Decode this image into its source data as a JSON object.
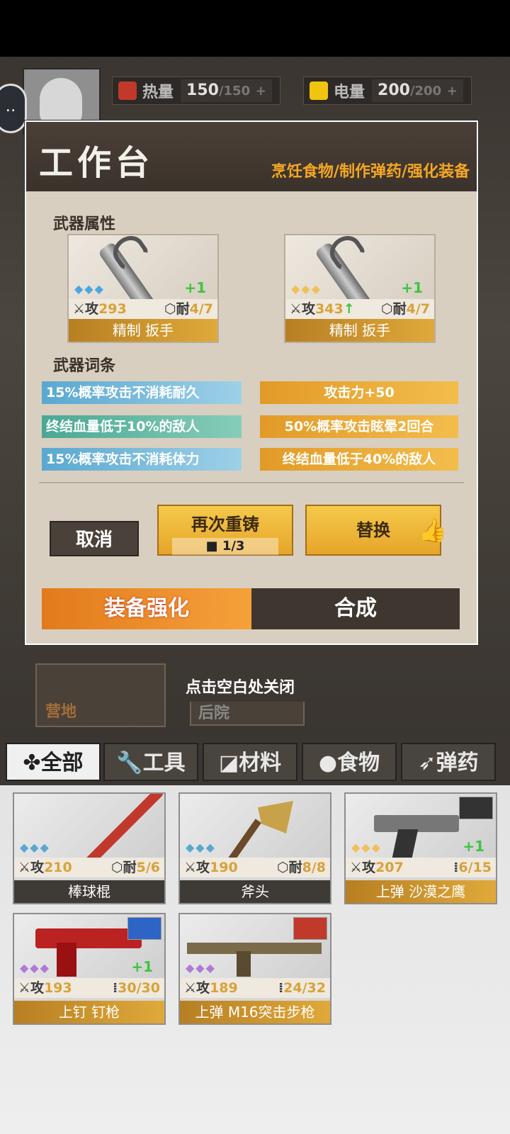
{
  "hud": {
    "heat_label": "热量",
    "heat_value": "150",
    "heat_max": "/150",
    "heat_plus": "+",
    "power_label": "电量",
    "power_value": "200",
    "power_max": "/200",
    "power_plus": "+"
  },
  "modal": {
    "title": "工作台",
    "subtitle": "烹饪食物/制作弹药/强化装备",
    "attr_label": "武器属性",
    "affix_label": "武器词条",
    "cards": [
      {
        "gems": "◆◆◆",
        "plus": "+1",
        "atk_label": "攻",
        "atk": "293",
        "dur_label": "耐",
        "dur": "4/7",
        "name": "精制 扳手"
      },
      {
        "gems": "◆◆◆",
        "plus": "+1",
        "atk_label": "攻",
        "atk": "343",
        "atk_up": "↑",
        "dur_label": "耐",
        "dur": "4/7",
        "name": "精制 扳手"
      }
    ],
    "affixes_left": [
      "15%概率攻击不消耗耐久",
      "终结血量低于10%的敌人",
      "15%概率攻击不消耗体力"
    ],
    "affixes_right": [
      "攻击力+50",
      "50%概率攻击眩晕2回合",
      "终结血量低于40%的敌人"
    ],
    "cancel": "取消",
    "recast": "再次重铸",
    "recast_count": "1/3",
    "replace": "替换",
    "tab_enhance": "装备强化",
    "tab_synth": "合成"
  },
  "close_hint": "点击空白处关闭",
  "bg_tiles": {
    "camp": "营地",
    "backyard": "后院"
  },
  "categories": [
    "全部",
    "工具",
    "材料",
    "食物",
    "弹药"
  ],
  "inventory": [
    {
      "atk_label": "攻",
      "atk": "210",
      "dur_label": "耐",
      "dur": "5/6",
      "name": "棒球棍",
      "gems": "◆◆◆"
    },
    {
      "atk_label": "攻",
      "atk": "190",
      "dur_label": "耐",
      "dur": "8/8",
      "name": "斧头",
      "gems": "◆◆◆"
    },
    {
      "atk_label": "攻",
      "atk": "207",
      "dur": "6/15",
      "name": "上弹 沙漠之鹰",
      "gems": "◆◆◆",
      "plus": "+1"
    },
    {
      "atk_label": "攻",
      "atk": "193",
      "dur": "30/30",
      "name": "上钉 钉枪",
      "gems": "◆◆◆",
      "plus": "+1"
    },
    {
      "atk_label": "攻",
      "atk": "189",
      "dur": "24/32",
      "name": "上弹 M16突击步枪",
      "gems": "◆◆◆"
    }
  ],
  "colors": {
    "accent": "#f5a623",
    "enhance": "#e27a1c",
    "green": "#3ec43e"
  }
}
